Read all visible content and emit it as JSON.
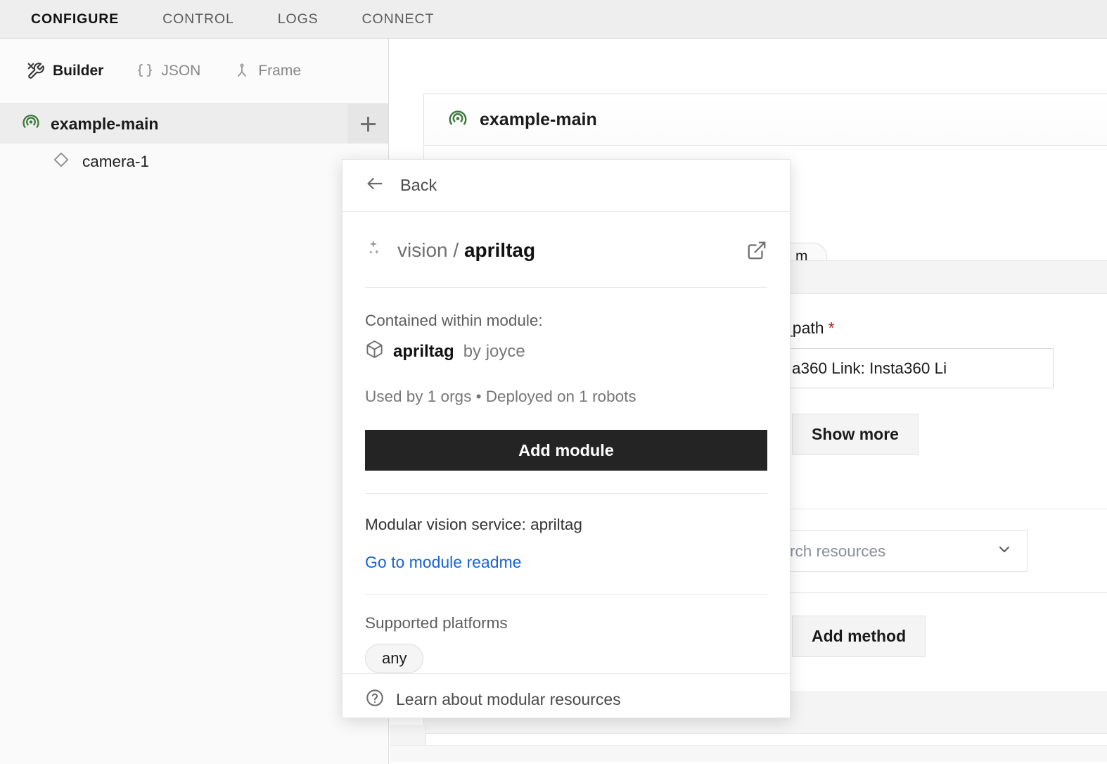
{
  "topnav": {
    "items": [
      {
        "label": "CONFIGURE",
        "active": true
      },
      {
        "label": "CONTROL",
        "active": false
      },
      {
        "label": "LOGS",
        "active": false
      },
      {
        "label": "CONNECT",
        "active": false
      }
    ]
  },
  "left_panel": {
    "modes": [
      {
        "label": "Builder",
        "icon": "tools-icon",
        "active": true
      },
      {
        "label": "JSON",
        "icon": "braces-icon",
        "active": false
      },
      {
        "label": "Frame",
        "icon": "frame-tree-icon",
        "active": false
      }
    ],
    "tree": {
      "root": {
        "label": "example-main",
        "icon": "machine-icon",
        "selected": true
      },
      "add_button_icon": "plus-icon",
      "children": [
        {
          "label": "camera-1",
          "icon": "diamond-icon"
        }
      ]
    }
  },
  "main": {
    "card_title": "example-main",
    "card_icon": "machine-icon",
    "type_pill": "m",
    "field_label": "_path",
    "field_required_marker": "*",
    "field_value": "a360 Link: Insta360 Li",
    "show_more_label": "Show more",
    "resource_select_value": "rch resources",
    "resource_select_caret": "chevron-down-icon",
    "add_method_label": "Add method"
  },
  "modal": {
    "back_label": "Back",
    "back_icon": "arrow-left-icon",
    "title_icon": "sparkles-icon",
    "title_namespace": "vision",
    "title_separator": "/",
    "title_name": "apriltag",
    "external_link_icon": "external-link-icon",
    "contained_label": "Contained within module:",
    "module_icon": "package-icon",
    "module_name": "apriltag",
    "module_author": "by joyce",
    "usage": "Used by 1 orgs  •  Deployed on 1 robots",
    "add_module_label": "Add module",
    "description": "Modular vision service: apriltag",
    "readme_link_label": "Go to module readme",
    "platforms_label": "Supported platforms",
    "platforms": [
      "any"
    ],
    "footer_icon": "question-circle-icon",
    "footer_label": "Learn about modular resources"
  },
  "colors": {
    "accent_link": "#1a62d6",
    "primary_button": "#242424",
    "machine_icon_green": "#3f7a3f",
    "required_red": "#b42318",
    "topnav_bg": "#eeeeee",
    "sidebar_bg": "#fafafa"
  }
}
